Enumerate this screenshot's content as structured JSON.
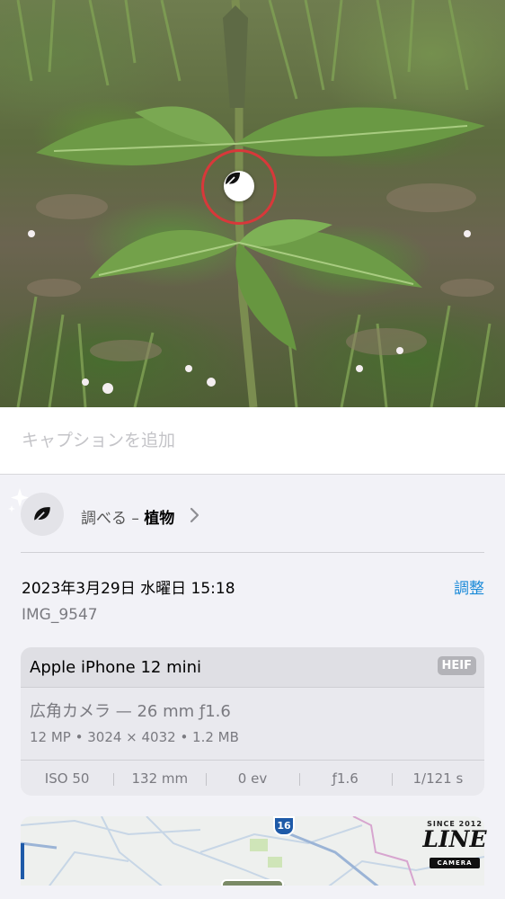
{
  "caption": {
    "placeholder": "キャプションを追加"
  },
  "lookup": {
    "prefix": "調べる – ",
    "subject": "植物",
    "icon": "leaf-icon"
  },
  "date": {
    "text": "2023年3月29日 水曜日 15:18",
    "adjust_label": "調整"
  },
  "filename": "IMG_9547",
  "device": {
    "name": "Apple iPhone 12 mini",
    "format": "HEIF",
    "lens": "広角カメラ — 26 mm ƒ1.6",
    "specs": "12 MP  •  3024 × 4032  •  1.2 MB"
  },
  "exif": [
    "ISO 50",
    "132 mm",
    "0 ev",
    "ƒ1.6",
    "1/121 s"
  ],
  "map": {
    "route_number": "16"
  },
  "watermark": {
    "since": "SINCE 2012",
    "brand": "LINE",
    "sub": "CAMERA"
  },
  "colors": {
    "accent": "#1a8ad8",
    "marker": "#d8383a"
  }
}
